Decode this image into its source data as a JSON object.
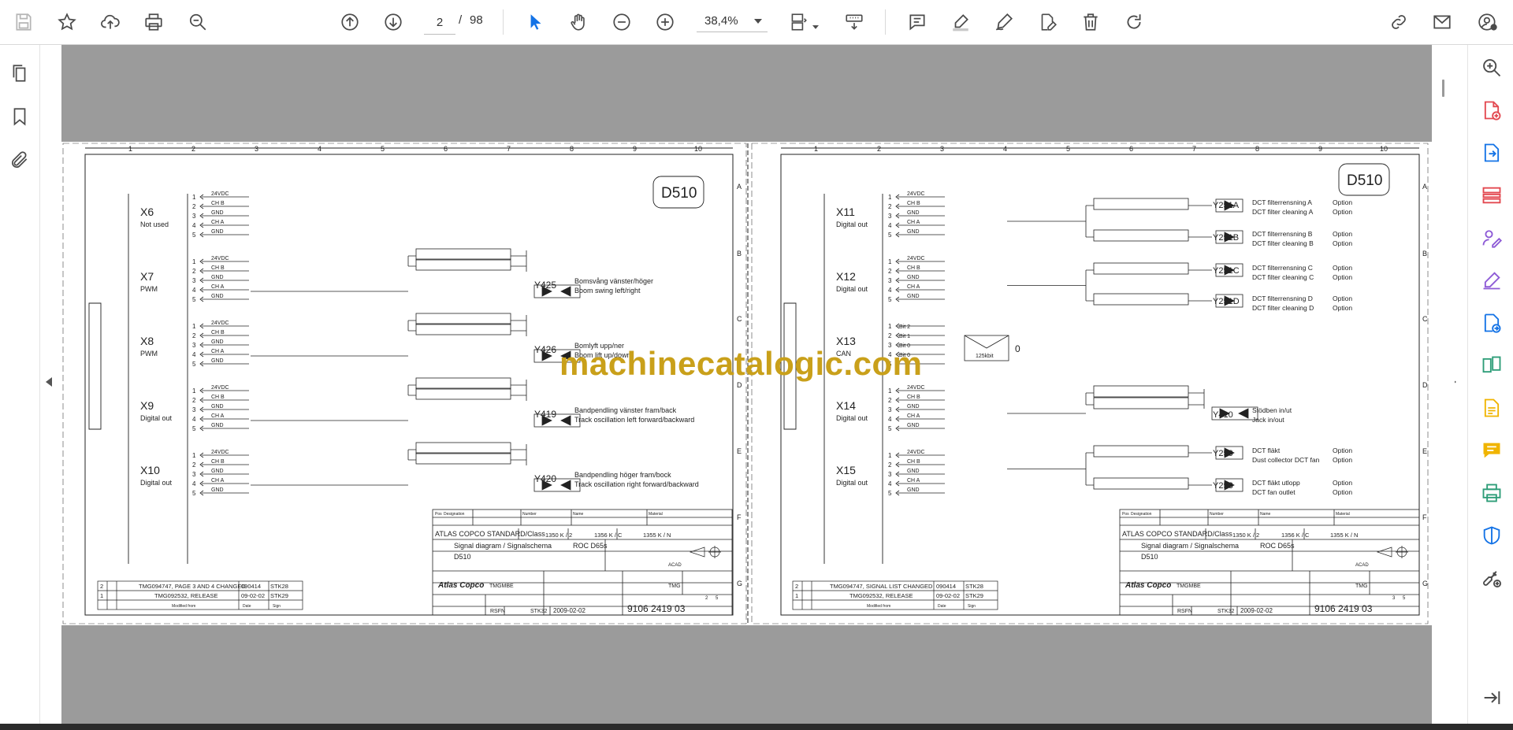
{
  "toolbar": {
    "current_page": "2",
    "page_separator": "/",
    "total_pages": "98",
    "zoom_value": "38,4%"
  },
  "colors": {
    "accent_blue": "#1473e6",
    "icon_gray": "#4b4b4b",
    "magenta": "#e34850",
    "purple": "#8d5ad6",
    "green": "#2d9d78",
    "yellow": "#f0b400",
    "page_bg": "#9b9b9b",
    "watermark": "#c9a01a"
  },
  "watermark": "machinecatalogic.com",
  "sheets": [
    {
      "code": "D510",
      "connectors": [
        {
          "name": "X6",
          "desc": "Not used"
        },
        {
          "name": "X7",
          "desc": "PWM"
        },
        {
          "name": "X8",
          "desc": "PWM"
        },
        {
          "name": "X9",
          "desc": "Digital out"
        },
        {
          "name": "X10",
          "desc": "Digital out"
        }
      ],
      "pin_labels": [
        "24VDC",
        "CH B",
        "GND",
        "CH A",
        "GND"
      ],
      "valves": [
        {
          "id": "Y425",
          "sv": "Bomsvång vänster/höger",
          "en": "Boom swing left/right"
        },
        {
          "id": "Y426",
          "sv": "Bomlyft upp/ner",
          "en": "Boom lift up/down"
        },
        {
          "id": "Y419",
          "sv": "Bandpendling vänster fram/back",
          "en": "Track oscillation left forward/backward"
        },
        {
          "id": "Y420",
          "sv": "Bandpendling höger fram/bock",
          "en": "Track oscillation right forward/backward"
        }
      ],
      "revisions": [
        {
          "no": "2",
          "text": "TMG094747, PAGE 3 AND 4 CHANGED",
          "date": "090414",
          "sign": "STK28"
        },
        {
          "no": "1",
          "text": "TMG092532, RELEASE",
          "date": "09-02-02",
          "sign": "STK29"
        }
      ],
      "sheet_no": "2",
      "sheet_of": "5"
    },
    {
      "code": "D510",
      "connectors": [
        {
          "name": "X11",
          "desc": "Digital out"
        },
        {
          "name": "X12",
          "desc": "Digital out"
        },
        {
          "name": "X13",
          "desc": "CAN"
        },
        {
          "name": "X14",
          "desc": "Digital out"
        },
        {
          "name": "X15",
          "desc": "Digital out"
        }
      ],
      "can_pins": [
        "Bit 2",
        "Bit 1",
        "Bit 0",
        "Bit 0"
      ],
      "can_rate": "125kbit",
      "can_value": "0",
      "outputs": [
        {
          "id": "Y251A",
          "sv": "DCT filterrensning A",
          "en": "DCT filter cleaning A",
          "opt": "Option"
        },
        {
          "id": "Y251B",
          "sv": "DCT filterrensning B",
          "en": "DCT filter cleaning B",
          "opt": "Option"
        },
        {
          "id": "Y251C",
          "sv": "DCT filterrensning C",
          "en": "DCT filter cleaning C",
          "opt": "Option"
        },
        {
          "id": "Y251D",
          "sv": "DCT filterrensning D",
          "en": "DCT filter cleaning D",
          "opt": "Option"
        },
        {
          "id": "Y410",
          "sv": "Stödben in/ut",
          "en": "Jack in/out",
          "opt": ""
        },
        {
          "id": "Y250",
          "sv": "DCT fläkt",
          "en": "Dust collector DCT fan",
          "opt": "Option"
        },
        {
          "id": "Y253",
          "sv": "DCT fläkt utlopp",
          "en": "DCT fan outlet",
          "opt": "Option"
        }
      ],
      "revisions": [
        {
          "no": "2",
          "text": "TMG094747, SIGNAL LIST CHANGED",
          "date": "090414",
          "sign": "STK28"
        },
        {
          "no": "1",
          "text": "TMG092532, RELEASE",
          "date": "09-02-02",
          "sign": "STK29"
        }
      ],
      "sheet_no": "3",
      "sheet_of": "5"
    }
  ],
  "titleblock": {
    "standard": "ATLAS COPCO STANDARD/Class",
    "class_1": "1350 K / 2",
    "class_2": "1356 K / C",
    "class_3": "1355 K / N",
    "title": "Signal diagram / Signalschema",
    "model": "ROC D65s",
    "name": "D510",
    "cad": "ACAD",
    "company": "Atlas Copco",
    "drawn": "TMGMBE",
    "owner": "TMG",
    "designer": "RSFN",
    "checker": "STK32",
    "date": "2009-02-02",
    "drawing_no": "9106 2419 03",
    "hdr_pos": "Pos",
    "hdr_designation": "Designation",
    "hdr_number": "Number",
    "hdr_name": "Name",
    "hdr_material": "Material",
    "hdr_scale": "Scale",
    "hdr_sheet": "Sheet",
    "hdr_replaces": "Replaces",
    "hdr_designer": "Design by",
    "hdr_date": "Date",
    "hdr_sign": "Sign",
    "hdr_modified": "Modified from"
  }
}
